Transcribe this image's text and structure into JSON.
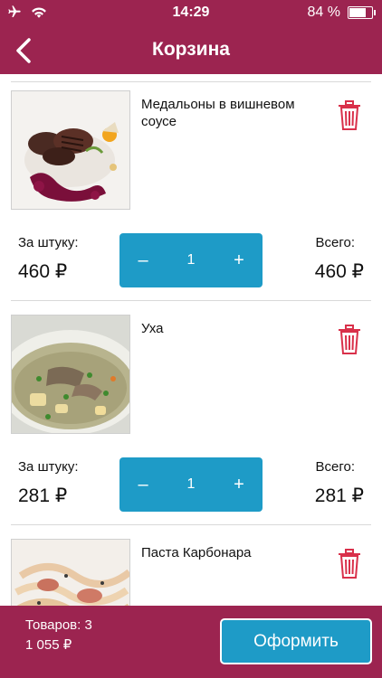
{
  "status": {
    "time": "14:29",
    "battery": "84 %",
    "battery_level": 0.84
  },
  "nav": {
    "title": "Корзина"
  },
  "items": [
    {
      "name": "Медальоны в вишневом соусе",
      "price_label": "За штуку:",
      "price": "460 ₽",
      "quantity": "1",
      "minus": "–",
      "plus": "+",
      "total_label": "Всего:",
      "total": "460 ₽"
    },
    {
      "name": "Уха",
      "price_label": "За штуку:",
      "price": "281 ₽",
      "quantity": "1",
      "minus": "–",
      "plus": "+",
      "total_label": "Всего:",
      "total": "281 ₽"
    },
    {
      "name": "Паста Карбонара"
    }
  ],
  "footer": {
    "count": "Товаров: 3",
    "sum": "1 055 ₽",
    "checkout_label": "Оформить"
  },
  "colors": {
    "brand": "#9c2450",
    "accent": "#1e9bc7",
    "trash": "#d9304a"
  },
  "icons": {
    "back": "chevron-left-icon",
    "trash": "trash-icon",
    "airplane": "airplane-icon",
    "wifi": "wifi-icon",
    "battery": "battery-icon"
  }
}
